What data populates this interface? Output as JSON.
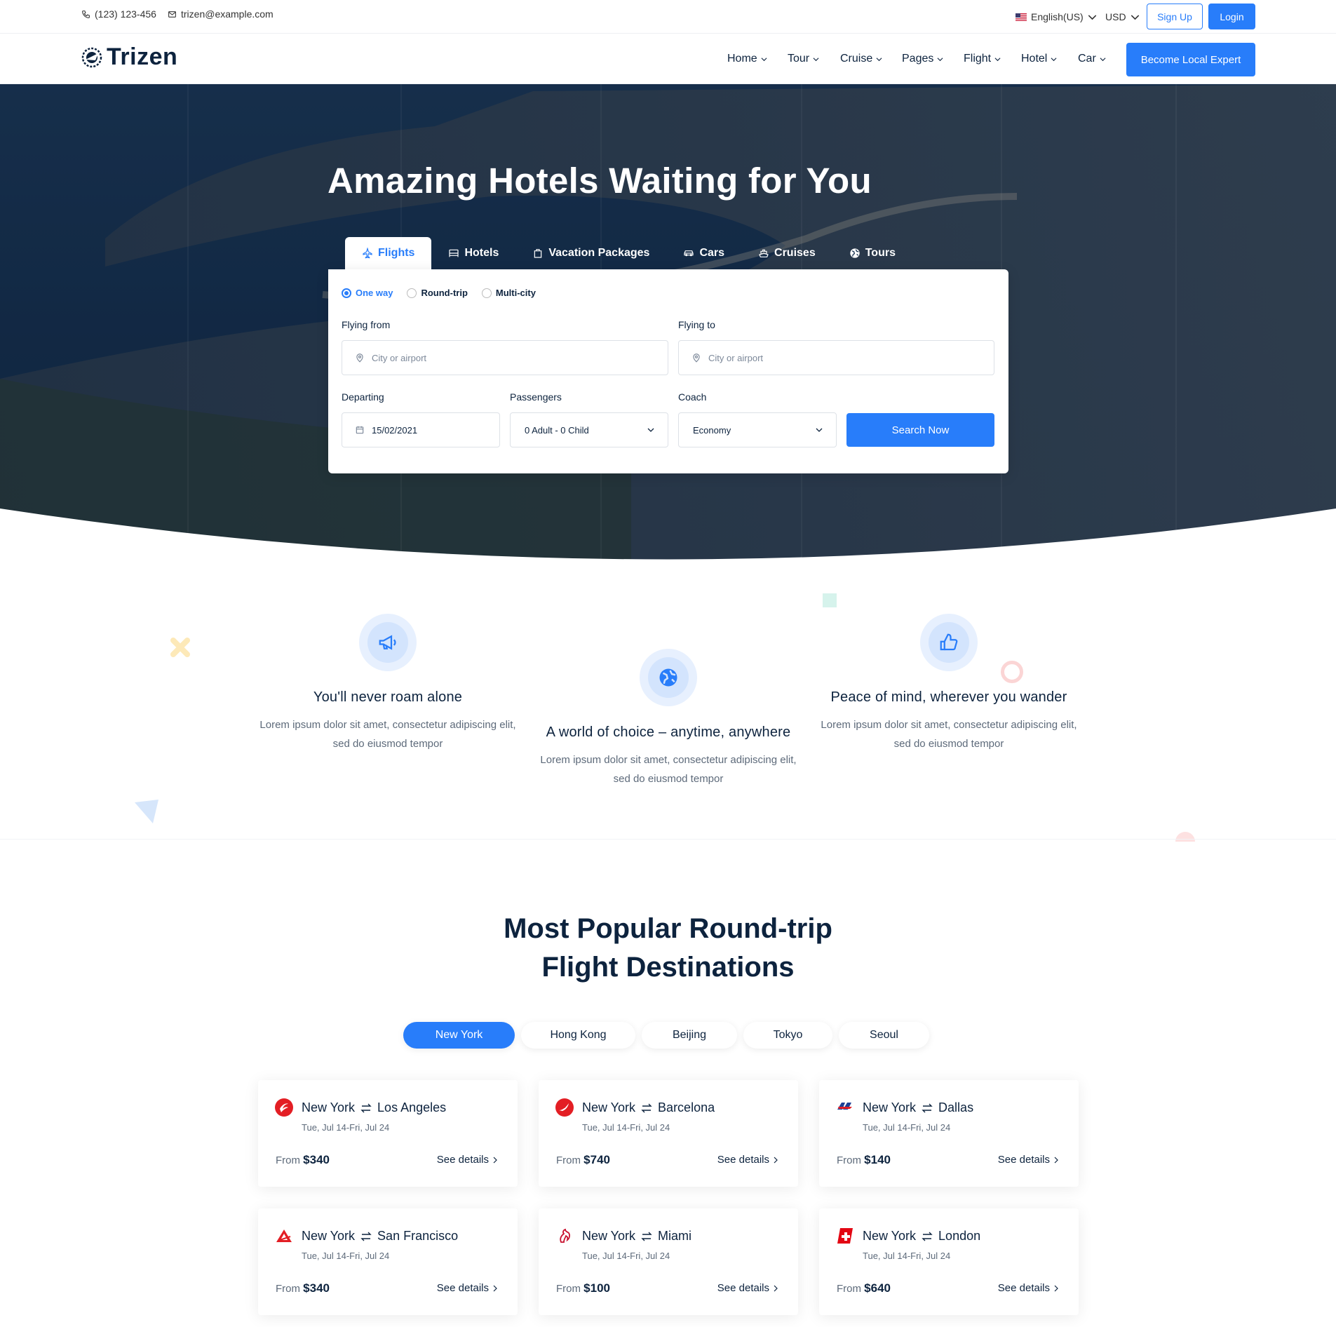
{
  "topbar": {
    "phone": "(123) 123-456",
    "email": "trizen@example.com",
    "language": "English(US)",
    "currency": "USD",
    "signup": "Sign Up",
    "login": "Login"
  },
  "nav": {
    "brand": "Trizen",
    "items": [
      "Home",
      "Tour",
      "Cruise",
      "Pages",
      "Flight",
      "Hotel",
      "Car"
    ],
    "cta": "Become Local Expert"
  },
  "hero": {
    "title": "Amazing Hotels Waiting for You",
    "tabs": [
      "Flights",
      "Hotels",
      "Vacation Packages",
      "Cars",
      "Cruises",
      "Tours"
    ],
    "trip_types": [
      "One way",
      "Round-trip",
      "Multi-city"
    ],
    "flying_from_label": "Flying from",
    "flying_from_placeholder": "City or airport",
    "flying_to_label": "Flying to",
    "flying_to_placeholder": "City or airport",
    "departing_label": "Departing",
    "departing_value": "15/02/2021",
    "passengers_label": "Passengers",
    "passengers_value": "0 Adult - 0 Child",
    "coach_label": "Coach",
    "coach_value": "Economy",
    "search_label": "Search Now"
  },
  "features": [
    {
      "title": "You'll never roam alone",
      "text": "Lorem ipsum dolor sit amet, consectetur adipiscing elit, sed do eiusmod tempor",
      "icon": "megaphone-icon"
    },
    {
      "title": "A world of choice – anytime, anywhere",
      "text": "Lorem ipsum dolor sit amet, consectetur adipiscing elit, sed do eiusmod tempor",
      "icon": "globe-icon"
    },
    {
      "title": "Peace of mind, wherever you wander",
      "text": "Lorem ipsum dolor sit amet, consectetur adipiscing elit, sed do eiusmod tempor",
      "icon": "thumbs-up-icon"
    }
  ],
  "popular": {
    "title_line1": "Most Popular Round-trip",
    "title_line2": "Flight Destinations",
    "cities": [
      "New York",
      "Hong Kong",
      "Beijing",
      "Tokyo",
      "Seoul"
    ],
    "cards": [
      {
        "from": "New York",
        "to": "Los Angeles",
        "dates": "Tue, Jul 14-Fri, Jul 24",
        "from_label": "From",
        "price": "$340",
        "details": "See details",
        "airline_color": "#e31e24"
      },
      {
        "from": "New York",
        "to": "Barcelona",
        "dates": "Tue, Jul 14-Fri, Jul 24",
        "from_label": "From",
        "price": "$740",
        "details": "See details",
        "airline_color": "#e31e24"
      },
      {
        "from": "New York",
        "to": "Dallas",
        "dates": "Tue, Jul 14-Fri, Jul 24",
        "from_label": "From",
        "price": "$140",
        "details": "See details",
        "airline_color": "#1c3f94"
      },
      {
        "from": "New York",
        "to": "San Francisco",
        "dates": "Tue, Jul 14-Fri, Jul 24",
        "from_label": "From",
        "price": "$340",
        "details": "See details",
        "airline_color": "#e31e24"
      },
      {
        "from": "New York",
        "to": "Miami",
        "dates": "Tue, Jul 14-Fri, Jul 24",
        "from_label": "From",
        "price": "$100",
        "details": "See details",
        "airline_color": "#c8102e"
      },
      {
        "from": "New York",
        "to": "London",
        "dates": "Tue, Jul 14-Fri, Jul 24",
        "from_label": "From",
        "price": "$640",
        "details": "See details",
        "airline_color": "#e30613"
      }
    ]
  },
  "colors": {
    "accent": "#287dfa",
    "navy": "#0d233e"
  }
}
